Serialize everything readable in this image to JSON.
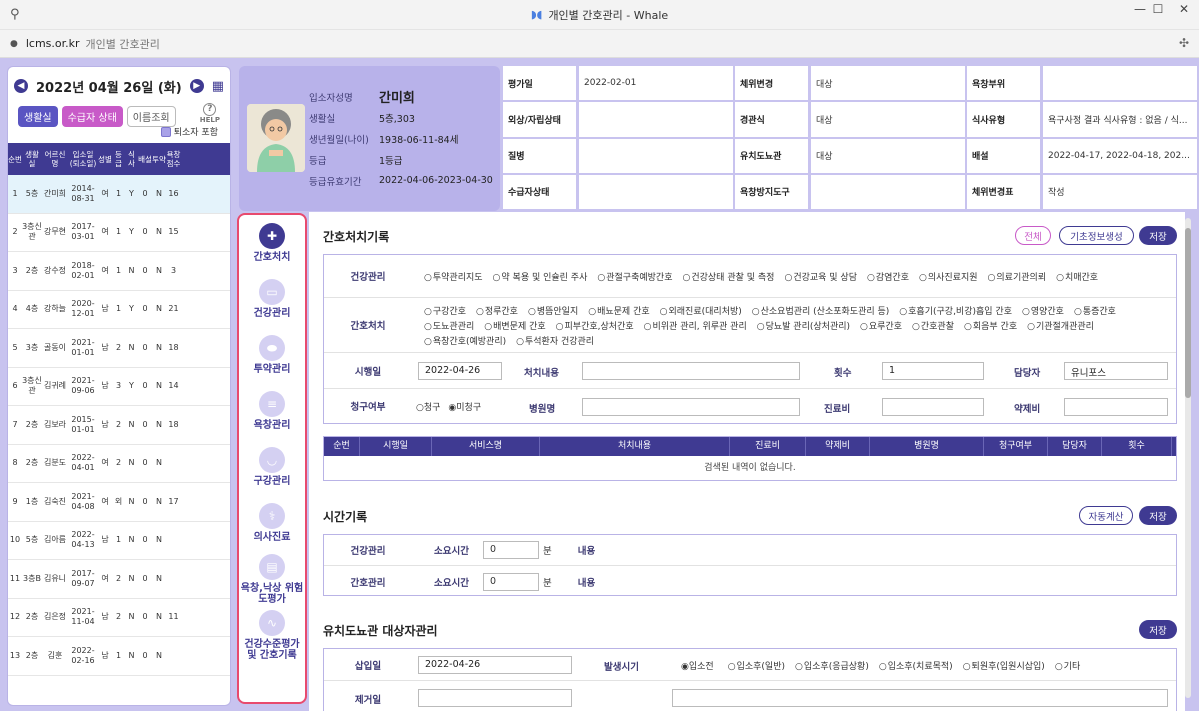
{
  "window": {
    "title": "개인별 간호관리 - Whale"
  },
  "address": {
    "url": "lcms.or.kr",
    "page_title": "개인별 간호관리"
  },
  "left": {
    "date": "2022년 04월 26일 (화)",
    "buttons": {
      "room": "생활실",
      "status": "수급자 상태",
      "name": "이름조회"
    },
    "help": "HELP",
    "retire": "퇴소자 포함",
    "headers": [
      "순번",
      "생활실",
      "어르신명",
      "입소일(퇴소일)",
      "성별",
      "등급",
      "식사",
      "배설",
      "투약",
      "욕창점수"
    ],
    "rows": [
      [
        "1",
        "5층",
        "간미희",
        "2014-08-31",
        "여",
        "1",
        "Y",
        "0",
        "N",
        "16"
      ],
      [
        "2",
        "3층신관",
        "강무현",
        "2017-03-01",
        "여",
        "1",
        "Y",
        "0",
        "N",
        "15"
      ],
      [
        "3",
        "2층",
        "강수정",
        "2018-02-01",
        "여",
        "1",
        "N",
        "0",
        "N",
        "3"
      ],
      [
        "4",
        "4층",
        "강하늘",
        "2020-12-01",
        "남",
        "1",
        "Y",
        "0",
        "N",
        "21"
      ],
      [
        "5",
        "3층",
        "골동이",
        "2021-01-01",
        "남",
        "2",
        "N",
        "0",
        "N",
        "18"
      ],
      [
        "6",
        "3층신관",
        "김귀례",
        "2021-09-06",
        "남",
        "3",
        "Y",
        "0",
        "N",
        "14"
      ],
      [
        "7",
        "2층",
        "김보라",
        "2015-01-01",
        "남",
        "2",
        "N",
        "0",
        "N",
        "18"
      ],
      [
        "8",
        "2층",
        "김분도",
        "2022-04-01",
        "여",
        "2",
        "N",
        "0",
        "N",
        ""
      ],
      [
        "9",
        "1층",
        "김숙진",
        "2021-04-08",
        "여",
        "외",
        "N",
        "0",
        "N",
        "17"
      ],
      [
        "10",
        "5층",
        "김아름",
        "2022-04-13",
        "남",
        "1",
        "N",
        "0",
        "N",
        ""
      ],
      [
        "11",
        "3층B",
        "김유니",
        "2017-09-07",
        "여",
        "2",
        "N",
        "0",
        "N",
        ""
      ],
      [
        "12",
        "2층",
        "김은정",
        "2021-11-04",
        "남",
        "2",
        "N",
        "0",
        "N",
        "11"
      ],
      [
        "13",
        "2층",
        "김훈",
        "2022-02-16",
        "남",
        "1",
        "N",
        "0",
        "N",
        ""
      ]
    ]
  },
  "patient": {
    "fields": [
      {
        "label": "입소자성명",
        "value": "간미희"
      },
      {
        "label": "생활실",
        "value": "5층,303"
      },
      {
        "label": "생년월일(나이)",
        "value": "1938-06-11-84세"
      },
      {
        "label": "등급",
        "value": "1등급"
      },
      {
        "label": "등급유효기간",
        "value": "2022-04-06-2023-04-30"
      }
    ]
  },
  "info": [
    [
      "평가일",
      "2022-02-01",
      "체위변경",
      "대상",
      "욕창부위",
      ""
    ],
    [
      "외상/자립상태",
      "",
      "경관식",
      "대상",
      "식사유형",
      "욕구사정 결과 식사유형 : 없음 / 식..."
    ],
    [
      "질병",
      "",
      "유치도뇨관",
      "대상",
      "배설",
      "2022-04-17, 2022-04-18, 202..."
    ],
    [
      "수급자상태",
      "",
      "욕창방지도구",
      "",
      "체위변경표",
      "작성"
    ]
  ],
  "nav": [
    {
      "label": "간호처치",
      "icon": "first-aid-kit-icon"
    },
    {
      "label": "건강관리",
      "icon": "monitor-icon"
    },
    {
      "label": "투약관리",
      "icon": "pill-icon"
    },
    {
      "label": "욕창관리",
      "icon": "bed-icon"
    },
    {
      "label": "구강관리",
      "icon": "tooth-icon"
    },
    {
      "label": "의사진료",
      "icon": "stethoscope-icon"
    },
    {
      "label": "욕창,낙상 위험도평가",
      "icon": "chart-icon"
    },
    {
      "label": "건강수준평가 및 간호기록",
      "icon": "pulse-icon"
    }
  ],
  "nursing": {
    "title": "간호처치기록",
    "btn_all": "전체",
    "btn_base": "기초정보생성",
    "btn_save": "저장",
    "health_label": "건강관리",
    "health_opts": [
      "투약관리지도",
      "약 복용 및 인슐린 주사",
      "관절구축예방간호",
      "건강상태 관찰 및 측정",
      "건강교육 및 상담",
      "감염간호",
      "의사진료지원",
      "의료기관의뢰",
      "치매간호"
    ],
    "care_label": "간호처치",
    "care_opts": [
      "구강간호",
      "정루간호",
      "병뜸안일지",
      "배뇨문제 간호",
      "외래진료(대리처방)",
      "산소요법관리 (산소포화도관리 등)",
      "호흡기(구강,비강)흡입 간호",
      "영양간호",
      "통증간호",
      "도뇨관관리",
      "배변문제 간호",
      "피부간호,상처간호",
      "비위관 관리, 위루관 관리",
      "당뇨발 관리(상처관리)",
      "요루간호",
      "간호관찰",
      "회음부 간호",
      "기관절개관관리",
      "욕창간호(예방관리)",
      "투석환자 건강관리"
    ],
    "date_label": "시행일",
    "date_value": "2022-04-26",
    "detail_label": "처치내용",
    "count_label": "횟수",
    "count_value": "1",
    "staff_label": "담당자",
    "staff_value": "유니포스",
    "claim_label": "청구여부",
    "claim_yes": "청구",
    "claim_no": "미청구",
    "hospital_label": "병원명",
    "fee_label": "진료비",
    "drug_label": "약제비"
  },
  "records_table": {
    "headers": [
      "순번",
      "시행일",
      "서비스명",
      "처치내용",
      "진료비",
      "약제비",
      "병원명",
      "청구여부",
      "담당자",
      "횟수"
    ],
    "empty": "검색된 내역이 없습니다."
  },
  "time": {
    "title": "시간기록",
    "btn_calc": "자동계산",
    "btn_save": "저장",
    "rows": [
      {
        "label": "건강관리",
        "time_label": "소요시간",
        "value": "0",
        "unit": "분",
        "content_label": "내용"
      },
      {
        "label": "간호관리",
        "time_label": "소요시간",
        "value": "0",
        "unit": "분",
        "content_label": "내용"
      }
    ]
  },
  "catheter": {
    "title": "유치도뇨관 대상자관리",
    "btn_save": "저장",
    "insert_label": "삽입일",
    "insert_value": "2022-04-26",
    "occur_label": "발생시기",
    "occur_opts": [
      "입소전",
      "입소후(일반)",
      "입소후(응급상황)",
      "입소후(치료목적)",
      "퇴원후(입원시삽입)",
      "기타"
    ],
    "remove_label": "제거일"
  }
}
